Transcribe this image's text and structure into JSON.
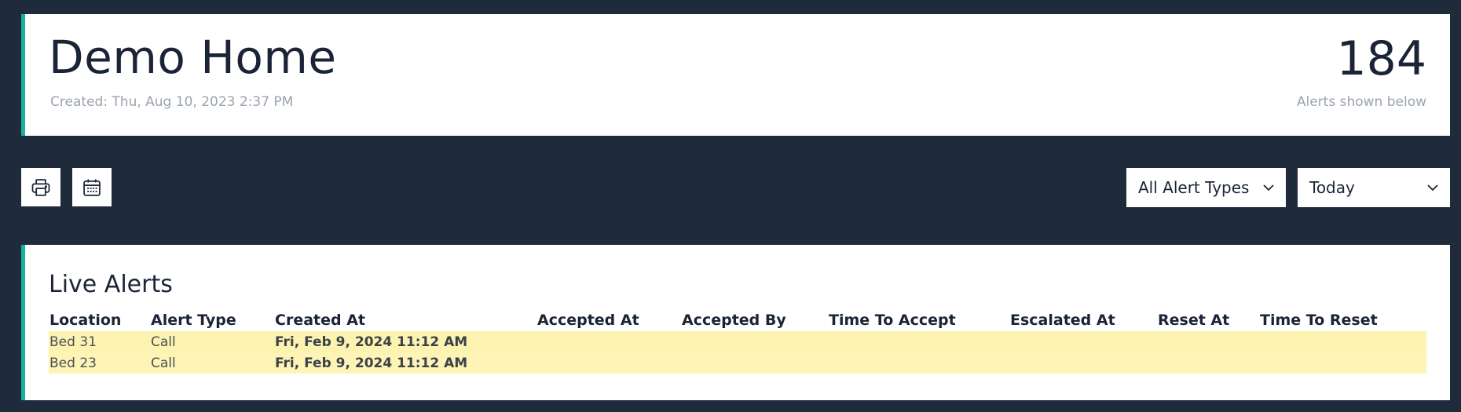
{
  "header": {
    "title": "Demo Home",
    "created": "Created: Thu, Aug 10, 2023 2:37 PM",
    "alert_count": "184",
    "alert_count_caption": "Alerts shown below"
  },
  "toolbar": {
    "print_icon": "printer-icon",
    "calendar_icon": "calendar-icon",
    "alert_type_select": "All Alert Types",
    "date_range_select": "Today"
  },
  "live_alerts": {
    "title": "Live Alerts",
    "columns": [
      "Location",
      "Alert Type",
      "Created At",
      "Accepted At",
      "Accepted By",
      "Time To Accept",
      "Escalated At",
      "Reset At",
      "Time To Reset"
    ],
    "rows": [
      {
        "location": "Bed 31",
        "alert_type": "Call",
        "created_at": "Fri, Feb 9, 2024 11:12 AM",
        "accepted_at": "",
        "accepted_by": "",
        "time_to_accept": "",
        "escalated_at": "",
        "reset_at": "",
        "time_to_reset": ""
      },
      {
        "location": "Bed 23",
        "alert_type": "Call",
        "created_at": "Fri, Feb 9, 2024 11:12 AM",
        "accepted_at": "",
        "accepted_by": "",
        "time_to_accept": "",
        "escalated_at": "",
        "reset_at": "",
        "time_to_reset": ""
      }
    ]
  },
  "colors": {
    "background": "#1f2a3b",
    "accent": "#16b3a2",
    "row_highlight": "#fdf3b1"
  }
}
